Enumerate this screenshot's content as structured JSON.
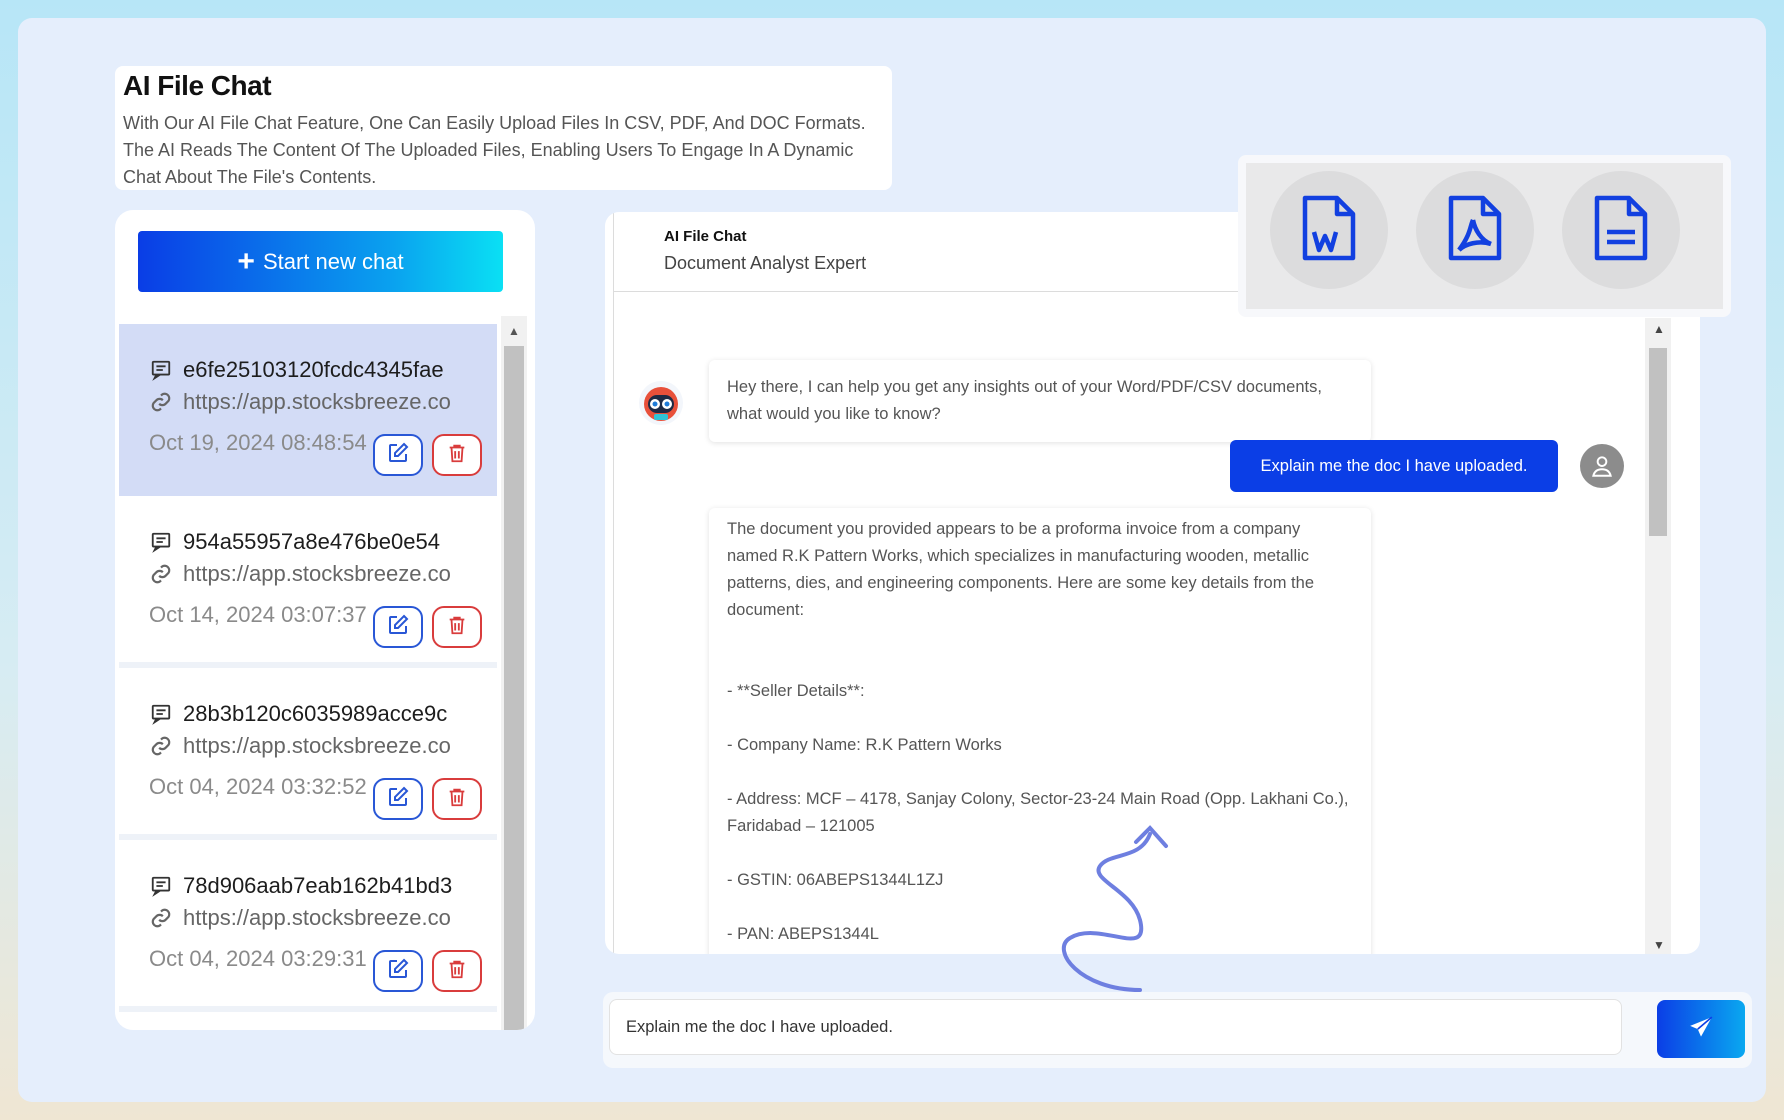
{
  "header": {
    "title": "AI File Chat",
    "description": "With Our AI File Chat Feature, One Can Easily Upload Files In CSV, PDF, And DOC Formats. The AI Reads The Content Of The Uploaded Files, Enabling Users To Engage In A Dynamic Chat About The File's Contents."
  },
  "sidebar": {
    "new_chat_label": "Start new chat",
    "chats": [
      {
        "id": "e6fe25103120fcdc4345fae",
        "url": "https://app.stocksbreeze.co",
        "date": "Oct 19, 2024 08:48:54",
        "active": true
      },
      {
        "id": "954a55957a8e476be0e54",
        "url": "https://app.stocksbreeze.co",
        "date": "Oct 14, 2024 03:07:37",
        "active": false
      },
      {
        "id": "28b3b120c6035989acce9c",
        "url": "https://app.stocksbreeze.co",
        "date": "Oct 04, 2024 03:32:52",
        "active": false
      },
      {
        "id": "78d906aab7eab162b41bd3",
        "url": "https://app.stocksbreeze.co",
        "date": "Oct 04, 2024 03:29:31",
        "active": false
      }
    ]
  },
  "chat": {
    "title": "AI File Chat",
    "subtitle": "Document Analyst Expert",
    "bot_greeting": "Hey there, I can help you get any insights out of your Word/PDF/CSV documents, what would you like to know?",
    "user_message": "Explain me the doc I have uploaded.",
    "bot_response": {
      "intro": "The document you provided appears to be a proforma invoice from a company named R.K Pattern Works, which specializes in manufacturing wooden, metallic patterns, dies, and engineering components. Here are some key details from the document:",
      "seller_heading": "- **Seller Details**:",
      "company_name": "- Company Name: R.K Pattern Works",
      "address": "- Address: MCF – 4178, Sanjay Colony, Sector-23-24 Main Road (Opp. Lakhani Co.), Faridabad – 121005",
      "gstin": "- GSTIN: 06ABEPS1344L1ZJ",
      "pan": "- PAN: ABEPS1344L"
    }
  },
  "doc_types": [
    "word-doc",
    "pdf-doc",
    "text-doc"
  ],
  "input": {
    "value": "Explain me the doc I have uploaded."
  },
  "colors": {
    "accent_blue": "#0b3ee6",
    "cyan": "#0ae0f4",
    "delete_red": "#d93c3c",
    "active_item_bg": "#d3dcf6"
  }
}
